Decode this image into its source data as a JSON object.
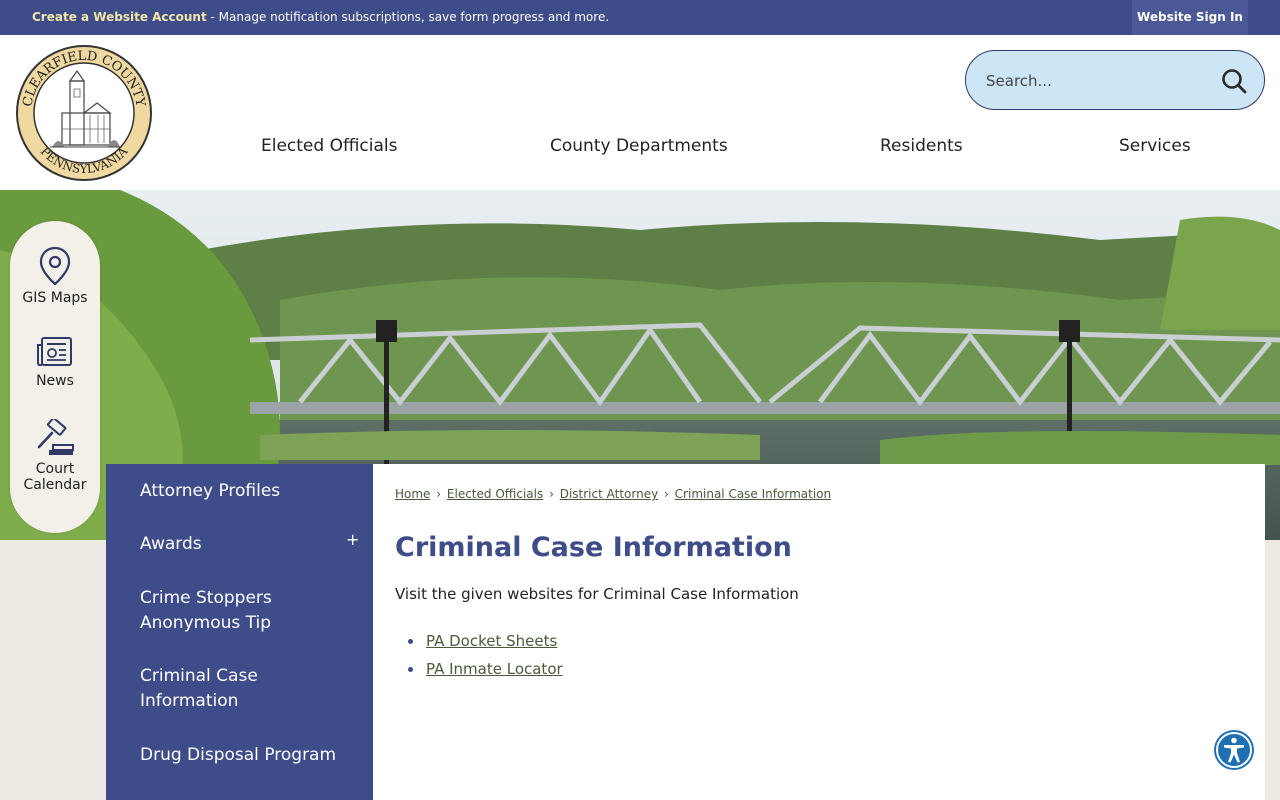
{
  "topbar": {
    "create_account": "Create a Website Account",
    "create_account_desc": " - Manage notification subscriptions, save form progress and more.",
    "sign_in": "Website Sign In"
  },
  "logo": {
    "county_text": "CLEARFIELD COUNTY",
    "state_text": "PENNSYLVANIA"
  },
  "search": {
    "placeholder": "Search...",
    "icon": "search-icon"
  },
  "nav": {
    "items": [
      "Elected Officials",
      "County Departments",
      "Residents",
      "Services"
    ]
  },
  "quick_links": [
    {
      "label": "GIS Maps",
      "icon": "map-pin-icon"
    },
    {
      "label": "News",
      "icon": "newspaper-icon"
    },
    {
      "label": "Court Calendar",
      "icon": "gavel-icon"
    }
  ],
  "side_nav": {
    "items": [
      {
        "label": "Attorney Profiles"
      },
      {
        "label": "Awards",
        "toggle": "+"
      },
      {
        "label": "Crime Stoppers Anonymous Tip"
      },
      {
        "label": "Criminal Case Information"
      },
      {
        "label": "Drug Disposal Program"
      }
    ]
  },
  "breadcrumb": [
    "Home",
    "Elected Officials",
    "District Attorney",
    "Criminal Case Information"
  ],
  "breadcrumb_sep": "›",
  "page": {
    "title": "Criminal Case Information",
    "intro": "Visit the given websites for Criminal Case Information",
    "links": [
      "PA Docket Sheets",
      "PA Inmate Locator"
    ]
  },
  "colors": {
    "brand": "#3e4c8a",
    "search_bg": "#cce6f6",
    "background": "#efe9e3",
    "accent_text": "#f2e6a8"
  },
  "accessibility": {
    "icon": "accessibility-icon"
  }
}
